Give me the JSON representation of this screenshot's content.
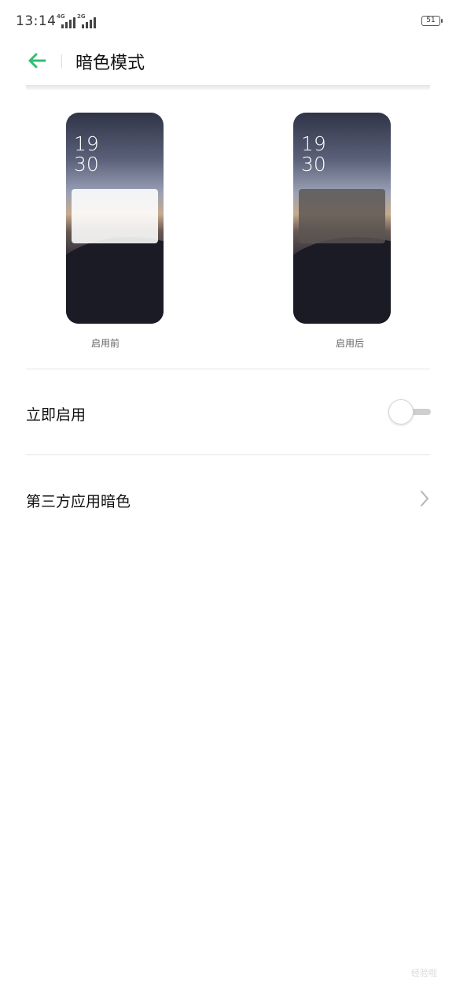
{
  "status_bar": {
    "time": "13:14",
    "signal_1_tag": "4G",
    "signal_2_tag": "2G",
    "battery": "51"
  },
  "header": {
    "back_icon": "arrow-left-icon",
    "title": "暗色模式",
    "accent_color": "#2fbf71"
  },
  "preview": {
    "before": {
      "clock_hour": "19",
      "clock_minute": "30",
      "caption": "启用前"
    },
    "after": {
      "clock_hour": "19",
      "clock_minute": "30",
      "caption": "启用后"
    }
  },
  "settings": {
    "enable_now": {
      "label": "立即启用",
      "toggle_on": false
    },
    "third_party": {
      "label": "第三方应用暗色",
      "icon": "chevron-right-icon"
    }
  },
  "watermark": "经验啦"
}
